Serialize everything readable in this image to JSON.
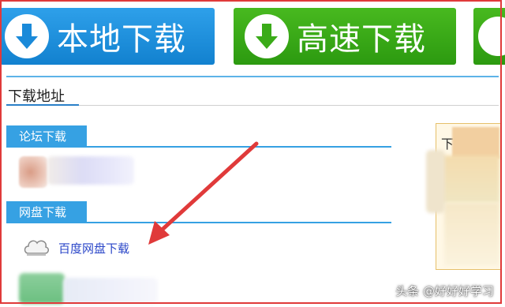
{
  "buttons": {
    "local_download": "本地下载",
    "fast_download": "高速下载"
  },
  "section": {
    "title": "下载地址"
  },
  "groups": {
    "forum": "论坛下载",
    "netdisk": "网盘下载"
  },
  "links": {
    "baidu": "百度网盘下载"
  },
  "right_panel": {
    "char": "下"
  },
  "watermark": "头条 @好好好学习",
  "colors": {
    "blue_button": "#1a8ad9",
    "green_button": "#3aab18",
    "tab_blue": "#36a1e3",
    "link_blue": "#2a46c8",
    "annotation_red": "#e03a3a"
  },
  "icons": {
    "download_arrow": "download-arrow-icon",
    "cloud": "cloud-icon"
  }
}
